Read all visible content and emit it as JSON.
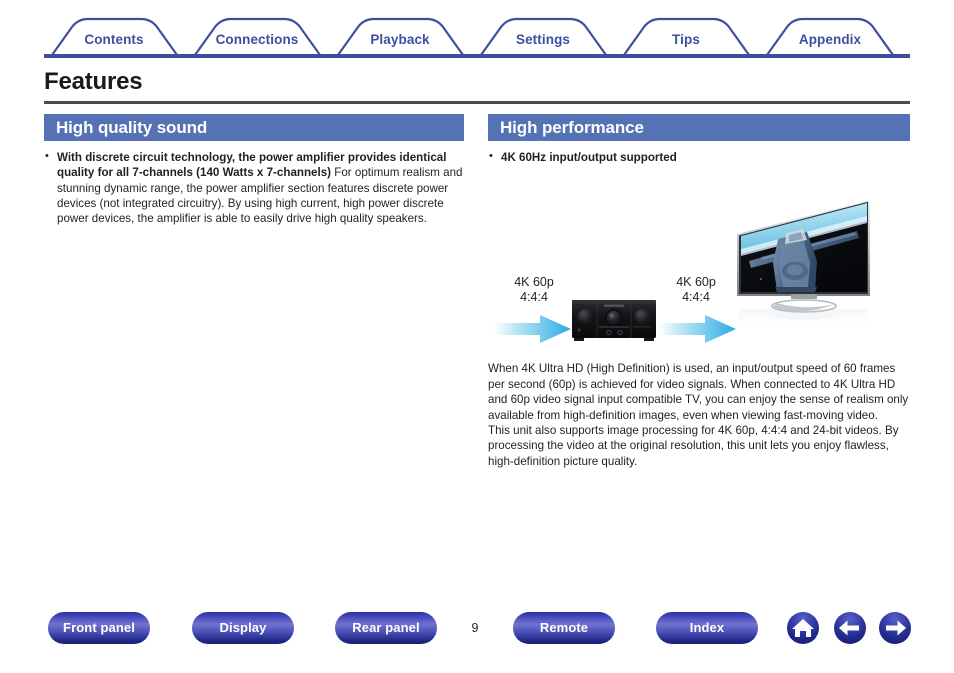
{
  "nav_tabs": [
    {
      "label": "Contents",
      "center": 114
    },
    {
      "label": "Connections",
      "center": 257
    },
    {
      "label": "Playback",
      "center": 400
    },
    {
      "label": "Settings",
      "center": 543
    },
    {
      "label": "Tips",
      "center": 686
    },
    {
      "label": "Appendix",
      "center": 830
    }
  ],
  "page": {
    "title": "Features",
    "number": "9"
  },
  "left_column": {
    "section_title": "High quality sound",
    "bullet": {
      "heading": "With discrete circuit technology, the power amplifier provides identical quality for all 7-channels (140 Watts x 7-channels)",
      "body": "For optimum realism and stunning dynamic range, the power amplifier section features discrete power devices (not integrated circuitry). By using high current, high power discrete power devices, the amplifier is able to easily drive high quality speakers."
    }
  },
  "right_column": {
    "section_title": "High performance",
    "bullet": {
      "heading": "4K 60Hz input/output supported"
    },
    "diagram": {
      "input_label_line1": "4K 60p",
      "input_label_line2": "4:4:4",
      "output_label_line1": "4K 60p",
      "output_label_line2": "4:4:4",
      "device_name": "av-receiver",
      "display_name": "television"
    },
    "body_paragraph_1": "When 4K Ultra HD (High Definition) is used, an input/output speed of 60 frames per second (60p) is achieved for video signals. When connected to 4K Ultra HD and 60p video signal input compatible TV, you can enjoy the sense of realism only available from high-definition images, even when viewing fast-moving video.",
    "body_paragraph_2": "This unit also supports image processing for 4K 60p, 4:4:4 and 24-bit videos. By processing the video at the original resolution, this unit lets you enjoy flawless, high-definition picture quality."
  },
  "footer": {
    "buttons": [
      {
        "label": "Front panel"
      },
      {
        "label": "Display"
      },
      {
        "label": "Rear panel"
      },
      {
        "label": "Remote"
      },
      {
        "label": "Index"
      }
    ],
    "icons": [
      {
        "name": "home-icon"
      },
      {
        "name": "arrow-left-icon"
      },
      {
        "name": "arrow-right-icon"
      }
    ]
  },
  "colors": {
    "tab_text": "#3f4fa0",
    "tab_outline": "#3f4fa0",
    "section_bar": "#5472b4",
    "title_rule": "#4d4d4d",
    "pill_blue": "#2a2f9c",
    "arrow_cyan": "#29abe2"
  }
}
